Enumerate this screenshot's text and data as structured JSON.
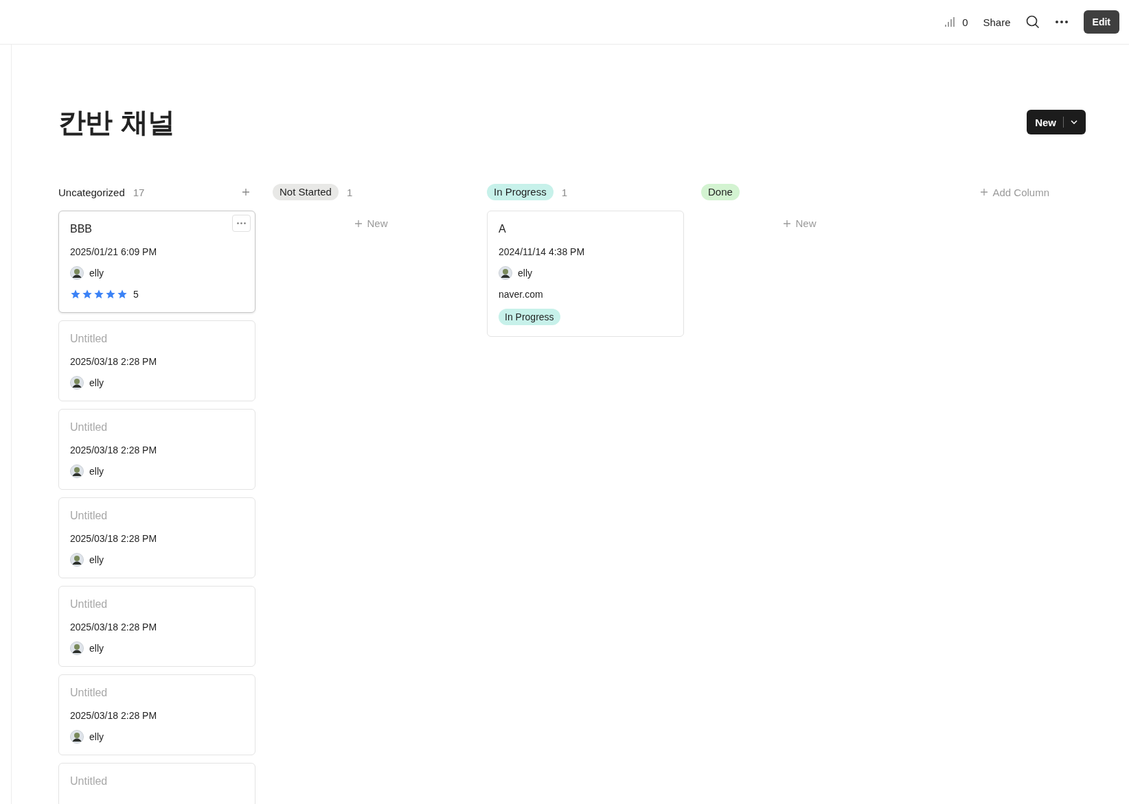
{
  "topbar": {
    "views": "0",
    "share": "Share",
    "edit": "Edit"
  },
  "title": "칸반 채널",
  "new_button": "New",
  "columns": [
    {
      "name": "Uncategorized",
      "count": "17",
      "kind": "plain",
      "cards": [
        {
          "title": "BBB",
          "untitled": false,
          "date": "2025/01/21 6:09 PM",
          "person": "elly",
          "stars": 5,
          "rating": "5",
          "menu": true
        },
        {
          "title": "Untitled",
          "untitled": true,
          "date": "2025/03/18 2:28 PM",
          "person": "elly"
        },
        {
          "title": "Untitled",
          "untitled": true,
          "date": "2025/03/18 2:28 PM",
          "person": "elly"
        },
        {
          "title": "Untitled",
          "untitled": true,
          "date": "2025/03/18 2:28 PM",
          "person": "elly"
        },
        {
          "title": "Untitled",
          "untitled": true,
          "date": "2025/03/18 2:28 PM",
          "person": "elly"
        },
        {
          "title": "Untitled",
          "untitled": true,
          "date": "2025/03/18 2:28 PM",
          "person": "elly"
        },
        {
          "title": "Untitled",
          "untitled": true
        }
      ]
    },
    {
      "name": "Not Started",
      "count": "1",
      "kind": "pill",
      "color": "#e8e8e6",
      "new_label": "New"
    },
    {
      "name": "In Progress",
      "count": "1",
      "kind": "pill",
      "color": "#c7f1ea",
      "cards": [
        {
          "title": "A",
          "untitled": false,
          "date": "2024/11/14 4:38 PM",
          "person": "elly",
          "url": "naver.com",
          "status": "In Progress",
          "color": "#c7f1ea"
        }
      ]
    },
    {
      "name": "Done",
      "kind": "pill",
      "color": "#d3f3d1",
      "new_label": "New"
    }
  ],
  "add_column": "Add Column"
}
